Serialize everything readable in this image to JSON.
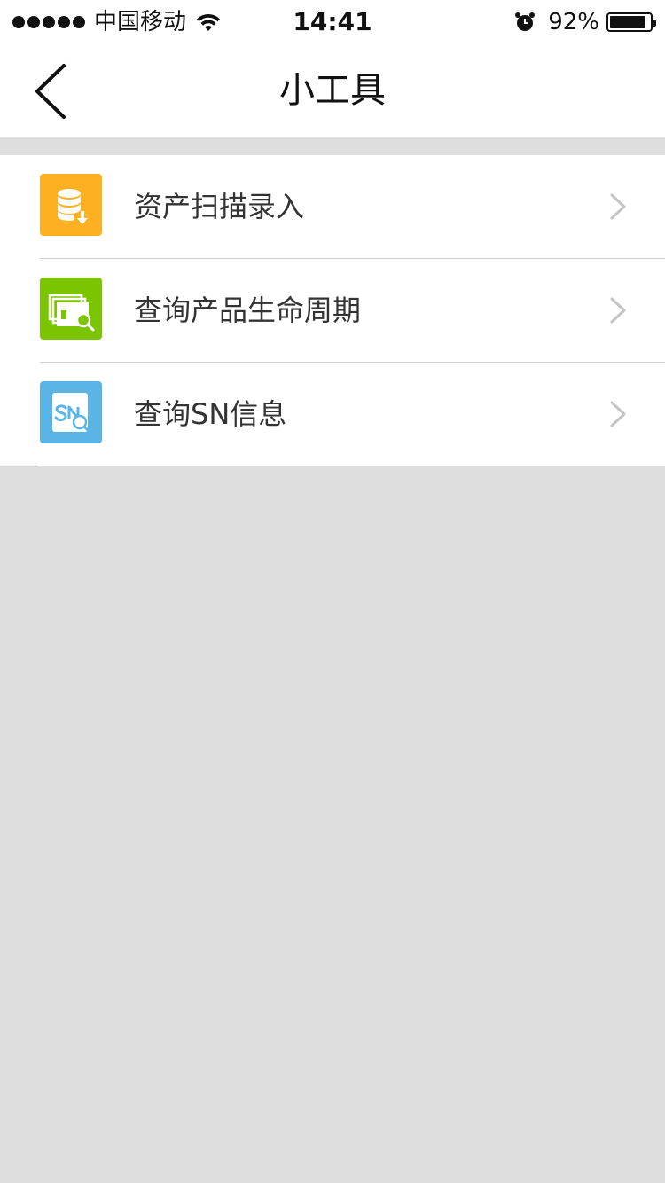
{
  "status_bar": {
    "carrier": "中国移动",
    "time": "14:41",
    "battery_percent": "92%",
    "battery_level": 0.92,
    "icons": [
      "signal-dots-icon",
      "wifi-icon",
      "alarm-icon",
      "battery-icon"
    ]
  },
  "nav": {
    "title": "小工具",
    "back_icon": "chevron-left-icon"
  },
  "tools": [
    {
      "label": "资产扫描录入",
      "icon": "database-import-icon",
      "color": "#fdb022"
    },
    {
      "label": "查询产品生命周期",
      "icon": "window-search-icon",
      "color": "#7bc400"
    },
    {
      "label": "查询SN信息",
      "icon": "sn-search-icon",
      "color": "#5ab4e5"
    }
  ],
  "colors": {
    "background": "#dedede",
    "surface": "#ffffff",
    "divider": "#cfcfcf",
    "chevron": "#c4c4c4"
  }
}
